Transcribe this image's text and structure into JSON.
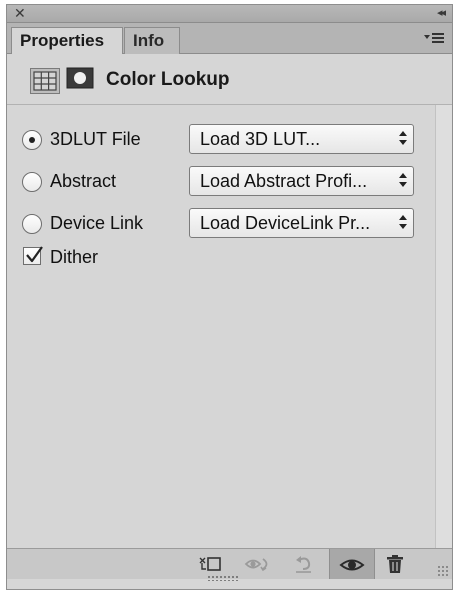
{
  "titlebar": {
    "close_icon": "close-icon",
    "collapse_icon": "double-chevron-left-icon"
  },
  "tabs": [
    {
      "label": "Properties",
      "active": true
    },
    {
      "label": "Info",
      "active": false
    }
  ],
  "panel_menu_icon": "panel-menu-icon",
  "header": {
    "title": "Color Lookup",
    "adjustment_icon": "grid-adjustment-icon",
    "mask_icon": "layer-mask-icon"
  },
  "options": [
    {
      "label": "3DLUT File",
      "selected": true,
      "dropdown": "Load 3D LUT..."
    },
    {
      "label": "Abstract",
      "selected": false,
      "dropdown": "Load Abstract Profi..."
    },
    {
      "label": "Device Link",
      "selected": false,
      "dropdown": "Load DeviceLink Pr..."
    }
  ],
  "dither": {
    "label": "Dither",
    "checked": true
  },
  "footer_icons": [
    "clip-to-layer-icon",
    "view-previous-state-icon",
    "reset-icon",
    "visibility-eye-icon",
    "trash-icon"
  ],
  "colors": {
    "panel_bg": "#d6d6d6",
    "tabbar_bg": "#b4b4b4",
    "border": "#8c8c8c",
    "disabled_icon": "#9a9a9a"
  }
}
